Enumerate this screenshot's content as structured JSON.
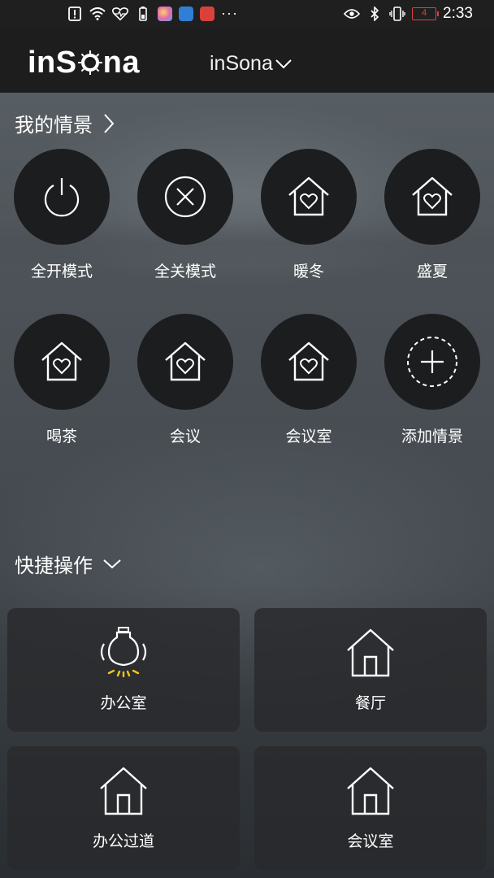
{
  "status_bar": {
    "time": "2:33",
    "battery": "4",
    "more": "···",
    "icons_left": [
      "alert-icon",
      "wifi-icon",
      "heart-rate-icon",
      "battery-saver-icon",
      "app-colorful-icon",
      "app-blue-icon",
      "app-red-icon"
    ],
    "icons_right": [
      "eye-icon",
      "bluetooth-icon",
      "vibrate-icon",
      "battery-icon"
    ]
  },
  "header": {
    "brand_pre": "inS",
    "brand_post": "na",
    "venue": "inSona"
  },
  "scenes_section": {
    "title": "我的情景",
    "items": [
      {
        "label": "全开模式",
        "icon": "power-icon"
      },
      {
        "label": "全关模式",
        "icon": "close-circle-icon"
      },
      {
        "label": "暖冬",
        "icon": "home-heart-icon"
      },
      {
        "label": "盛夏",
        "icon": "home-heart-icon"
      },
      {
        "label": "喝茶",
        "icon": "home-heart-icon"
      },
      {
        "label": "会议",
        "icon": "home-heart-icon"
      },
      {
        "label": "会议室",
        "icon": "home-heart-icon"
      },
      {
        "label": "添加情景",
        "icon": "add-circle-icon"
      }
    ]
  },
  "quick_section": {
    "title": "快捷操作",
    "items": [
      {
        "label": "办公室",
        "icon": "light-bulb-icon"
      },
      {
        "label": "餐厅",
        "icon": "home-icon"
      },
      {
        "label": "办公过道",
        "icon": "home-icon"
      },
      {
        "label": "会议室",
        "icon": "home-icon"
      }
    ]
  },
  "colors": {
    "header_bg": "#1d1d1d",
    "circle_bg": "#1b1d1f",
    "bulb_glow": "#f5c518",
    "battery_low": "#e04040"
  }
}
